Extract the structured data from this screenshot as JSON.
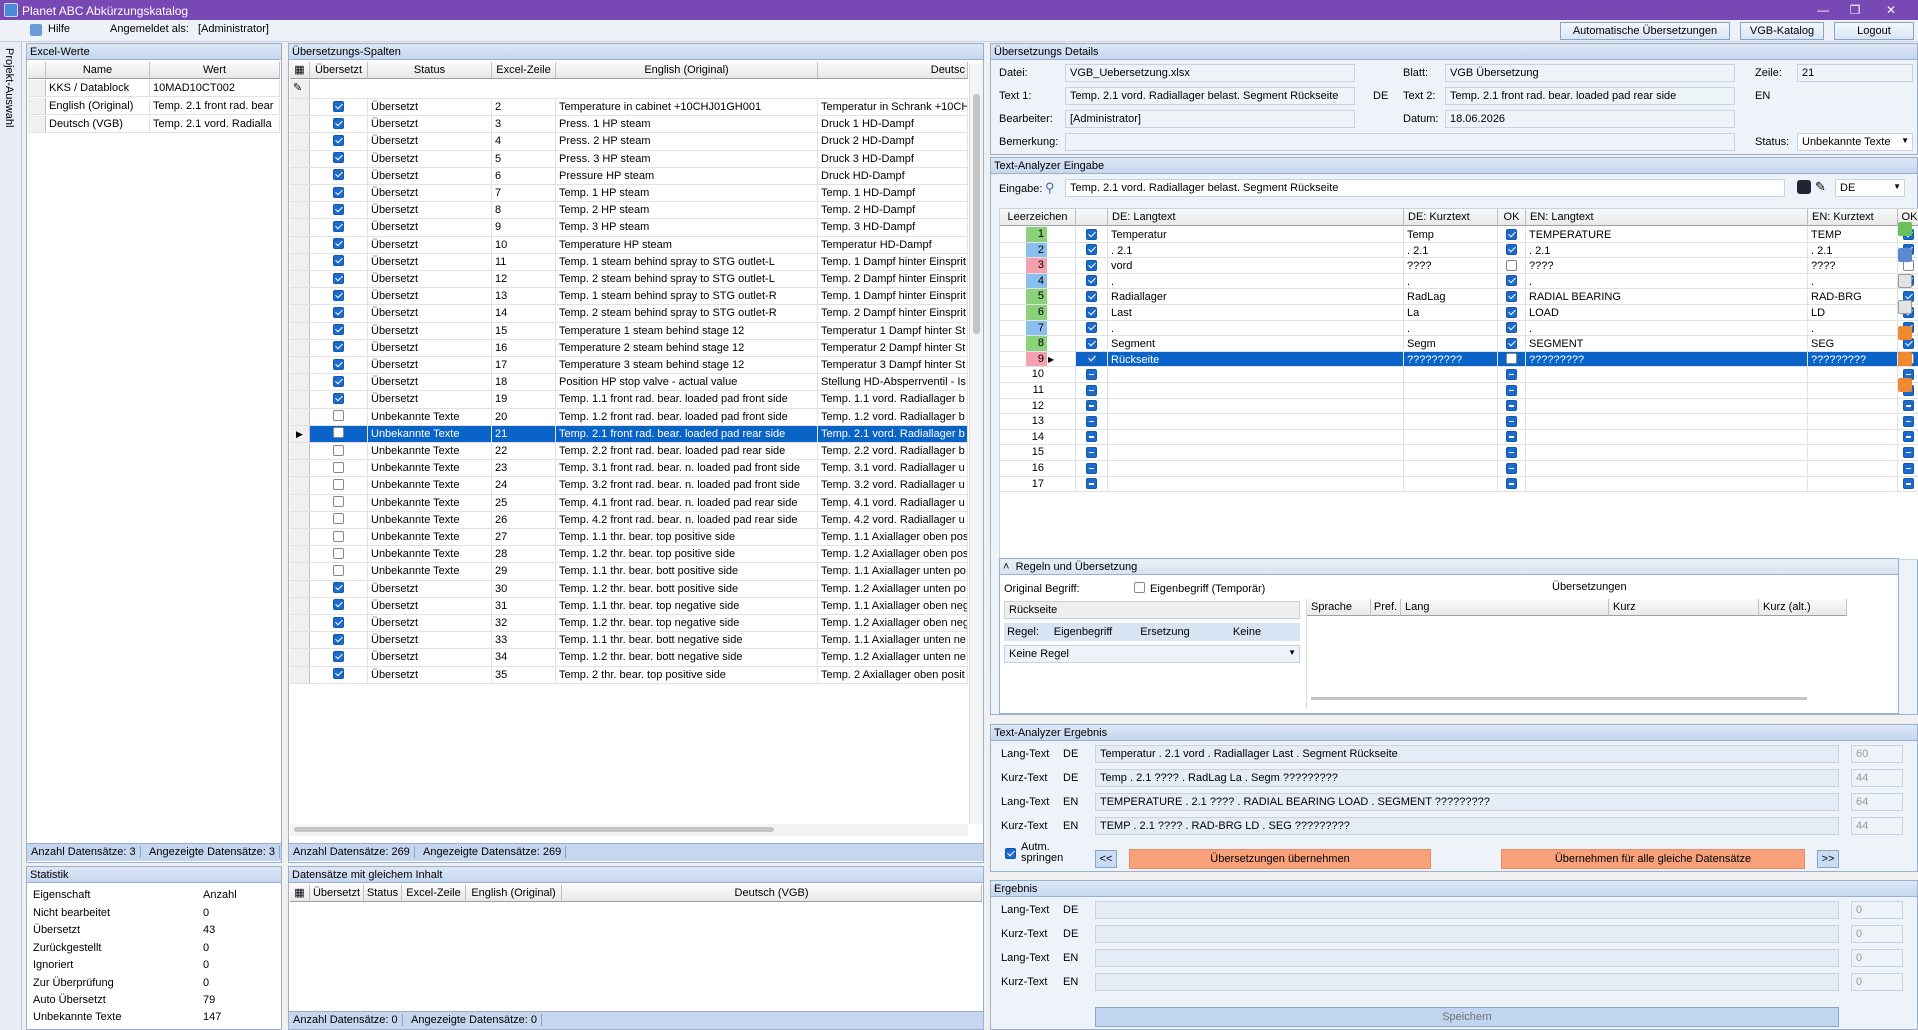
{
  "window": {
    "title": "Planet ABC Abkürzungskatalog"
  },
  "menu": {
    "help": "Hilfe",
    "logged_in_label": "Angemeldet als:",
    "logged_in_user": "[Administrator]",
    "btn_auto": "Automatische Übersetzungen",
    "btn_vgb": "VGB-Katalog",
    "btn_logout": "Logout"
  },
  "side": {
    "label": "Projekt-Auswahl"
  },
  "excel": {
    "title": "Excel-Werte",
    "col_name": "Name",
    "col_value": "Wert",
    "rows": [
      {
        "name": "KKS / Datablock",
        "value": "10MAD10CT002"
      },
      {
        "name": "English (Original)",
        "value": "Temp. 2.1 front rad. bear"
      },
      {
        "name": "Deutsch (VGB)",
        "value": "Temp. 2.1 vord. Radialla"
      }
    ],
    "count": "Anzahl Datensätze: 3",
    "shown": "Angezeigte Datensätze: 3"
  },
  "stats": {
    "title": "Statistik",
    "col_prop": "Eigenschaft",
    "col_count": "Anzahl",
    "rows": [
      {
        "k": "Nicht bearbeitet",
        "v": "0"
      },
      {
        "k": "Übersetzt",
        "v": "43"
      },
      {
        "k": "Zurückgestellt",
        "v": "0"
      },
      {
        "k": "Ignoriert",
        "v": "0"
      },
      {
        "k": "Zur Überprüfung",
        "v": "0"
      },
      {
        "k": "Auto Übersetzt",
        "v": "79"
      },
      {
        "k": "Unbekannte Texte",
        "v": "147"
      }
    ]
  },
  "trans": {
    "title": "Übersetzungs-Spalten",
    "col_ue": "Übersetzt",
    "col_status": "Status",
    "col_zeile": "Excel-Zeile",
    "col_en": "English (Original)",
    "col_de": "Deutsc",
    "rows": [
      {
        "c": true,
        "s": "Übersetzt",
        "z": "2",
        "en": "Temperature in cabinet +10CHJ01GH001",
        "de": "Temperatur in Schrank +10CH"
      },
      {
        "c": true,
        "s": "Übersetzt",
        "z": "3",
        "en": "Press. 1 HP steam",
        "de": "Druck 1 HD-Dampf"
      },
      {
        "c": true,
        "s": "Übersetzt",
        "z": "4",
        "en": "Press. 2 HP steam",
        "de": "Druck 2 HD-Dampf"
      },
      {
        "c": true,
        "s": "Übersetzt",
        "z": "5",
        "en": "Press. 3 HP steam",
        "de": "Druck 3 HD-Dampf"
      },
      {
        "c": true,
        "s": "Übersetzt",
        "z": "6",
        "en": "Pressure HP steam",
        "de": "Druck HD-Dampf"
      },
      {
        "c": true,
        "s": "Übersetzt",
        "z": "7",
        "en": "Temp. 1 HP steam",
        "de": "Temp. 1 HD-Dampf"
      },
      {
        "c": true,
        "s": "Übersetzt",
        "z": "8",
        "en": "Temp. 2 HP steam",
        "de": "Temp. 2 HD-Dampf"
      },
      {
        "c": true,
        "s": "Übersetzt",
        "z": "9",
        "en": "Temp. 3 HP steam",
        "de": "Temp. 3 HD-Dampf"
      },
      {
        "c": true,
        "s": "Übersetzt",
        "z": "10",
        "en": "Temperature HP steam",
        "de": "Temperatur HD-Dampf"
      },
      {
        "c": true,
        "s": "Übersetzt",
        "z": "11",
        "en": "Temp. 1 steam behind spray to STG outlet-L",
        "de": "Temp. 1 Dampf hinter Einsprit"
      },
      {
        "c": true,
        "s": "Übersetzt",
        "z": "12",
        "en": "Temp. 2 steam behind spray to STG outlet-L",
        "de": "Temp. 2 Dampf hinter Einsprit"
      },
      {
        "c": true,
        "s": "Übersetzt",
        "z": "13",
        "en": "Temp. 1 steam behind spray to STG outlet-R",
        "de": "Temp. 1 Dampf hinter Einsprit"
      },
      {
        "c": true,
        "s": "Übersetzt",
        "z": "14",
        "en": "Temp. 2 steam behind spray to STG outlet-R",
        "de": "Temp. 2 Dampf hinter Einsprit"
      },
      {
        "c": true,
        "s": "Übersetzt",
        "z": "15",
        "en": "Temperature 1 steam behind stage 12",
        "de": "Temperatur 1 Dampf hinter St"
      },
      {
        "c": true,
        "s": "Übersetzt",
        "z": "16",
        "en": "Temperature 2 steam behind stage 12",
        "de": "Temperatur 2 Dampf hinter St"
      },
      {
        "c": true,
        "s": "Übersetzt",
        "z": "17",
        "en": "Temperature 3 steam behind stage 12",
        "de": "Temperatur 3 Dampf hinter St"
      },
      {
        "c": true,
        "s": "Übersetzt",
        "z": "18",
        "en": "Position HP stop valve - actual value",
        "de": "Stellung HD-Absperrventil - Is"
      },
      {
        "c": true,
        "s": "Übersetzt",
        "z": "19",
        "en": "Temp. 1.1 front rad. bear. loaded pad front side",
        "de": "Temp. 1.1 vord. Radiallager b"
      },
      {
        "c": false,
        "s": "Unbekannte Texte",
        "z": "20",
        "en": "Temp. 1.2 front rad. bear. loaded pad front side",
        "de": "Temp. 1.2 vord. Radiallager b"
      },
      {
        "c": false,
        "s": "Unbekannte Texte",
        "z": "21",
        "en": "Temp. 2.1 front rad. bear. loaded pad rear side",
        "de": "Temp. 2.1 vord. Radiallager b",
        "sel": true
      },
      {
        "c": false,
        "s": "Unbekannte Texte",
        "z": "22",
        "en": "Temp. 2.2 front rad. bear. loaded pad rear side",
        "de": "Temp. 2.2 vord. Radiallager b"
      },
      {
        "c": false,
        "s": "Unbekannte Texte",
        "z": "23",
        "en": "Temp. 3.1 front rad. bear. n. loaded pad front side",
        "de": "Temp. 3.1 vord. Radiallager u"
      },
      {
        "c": false,
        "s": "Unbekannte Texte",
        "z": "24",
        "en": "Temp. 3.2 front rad. bear. n. loaded pad front side",
        "de": "Temp. 3.2 vord. Radiallager u"
      },
      {
        "c": false,
        "s": "Unbekannte Texte",
        "z": "25",
        "en": "Temp. 4.1 front rad. bear. n. loaded pad rear side",
        "de": "Temp. 4.1 vord. Radiallager u"
      },
      {
        "c": false,
        "s": "Unbekannte Texte",
        "z": "26",
        "en": "Temp. 4.2 front rad. bear. n. loaded pad rear side",
        "de": "Temp. 4.2 vord. Radiallager u"
      },
      {
        "c": false,
        "s": "Unbekannte Texte",
        "z": "27",
        "en": "Temp. 1.1 thr. bear. top positive side",
        "de": "Temp. 1.1 Axiallager oben pos"
      },
      {
        "c": false,
        "s": "Unbekannte Texte",
        "z": "28",
        "en": "Temp. 1.2 thr. bear. top positive side",
        "de": "Temp. 1.2 Axiallager oben pos"
      },
      {
        "c": false,
        "s": "Unbekannte Texte",
        "z": "29",
        "en": "Temp. 1.1 thr. bear. bott positive side",
        "de": "Temp. 1.1 Axiallager unten po"
      },
      {
        "c": true,
        "s": "Übersetzt",
        "z": "30",
        "en": "Temp. 1.2 thr. bear. bott positive side",
        "de": "Temp. 1.2 Axiallager unten po"
      },
      {
        "c": true,
        "s": "Übersetzt",
        "z": "31",
        "en": "Temp. 1.1 thr. bear. top negative side",
        "de": "Temp. 1.1 Axiallager oben neg"
      },
      {
        "c": true,
        "s": "Übersetzt",
        "z": "32",
        "en": "Temp. 1.2 thr. bear. top negative side",
        "de": "Temp. 1.2 Axiallager oben neg"
      },
      {
        "c": true,
        "s": "Übersetzt",
        "z": "33",
        "en": "Temp. 1.1 thr. bear. bott negative side",
        "de": "Temp. 1.1 Axiallager unten ne"
      },
      {
        "c": true,
        "s": "Übersetzt",
        "z": "34",
        "en": "Temp. 1.2 thr. bear. bott negative side",
        "de": "Temp. 1.2 Axiallager unten ne"
      },
      {
        "c": true,
        "s": "Übersetzt",
        "z": "35",
        "en": "Temp. 2 thr. bear. top positive side",
        "de": "Temp. 2 Axiallager oben posit"
      }
    ],
    "count": "Anzahl Datensätze: 269",
    "shown": "Angezeigte Datensätze: 269"
  },
  "same": {
    "title": "Datensätze mit gleichem Inhalt",
    "col_ue": "Übersetzt",
    "col_status": "Status",
    "col_zeile": "Excel-Zeile",
    "col_en": "English (Original)",
    "col_de": "Deutsch (VGB)",
    "count": "Anzahl Datensätze: 0",
    "shown": "Angezeigte Datensätze: 0"
  },
  "details": {
    "title": "Übersetzungs Details",
    "datei_l": "Datei:",
    "datei": "VGB_Uebersetzung.xlsx",
    "blatt_l": "Blatt:",
    "blatt": "VGB Übersetzung",
    "zeile_l": "Zeile:",
    "zeile": "21",
    "text1_l": "Text 1:",
    "text1": "Temp. 2.1 vord. Radiallager belast. Segment Rückseite",
    "lang1": "DE",
    "text2_l": "Text 2:",
    "text2": "Temp. 2.1 front rad. bear. loaded pad rear side",
    "lang2": "EN",
    "bearb_l": "Bearbeiter:",
    "bearb": "[Administrator]",
    "datum_l": "Datum:",
    "datum": "18.06.2026",
    "bem_l": "Bemerkung:",
    "bem": "",
    "status_l": "Status:",
    "status": "Unbekannte Texte"
  },
  "analyzer": {
    "title": "Text-Analyzer Eingabe",
    "eingabe_l": "Eingabe:",
    "eingabe": "Temp. 2.1 vord. Radiallager belast. Segment Rückseite",
    "lang": "DE",
    "col_lz": "Leerzeichen",
    "col_de_lang": "DE: Langtext",
    "col_de_kurz": "DE: Kurztext",
    "col_ok": "OK",
    "col_en_lang": "EN: Langtext",
    "col_en_kurz": "EN: Kurztext",
    "col_ok2": "OK",
    "rows": [
      {
        "n": "1",
        "col": "#8ad27a",
        "c1": "on",
        "dl": "Temperatur",
        "dk": "Temp",
        "ok": "on",
        "el": "TEMPERATURE",
        "ek": "TEMP",
        "ok2": "on"
      },
      {
        "n": "2",
        "col": "#8ac0f0",
        "c1": "on",
        "dl": ". 2.1",
        "dk": ". 2.1",
        "ok": "on",
        "el": ". 2.1",
        "ek": ". 2.1",
        "ok2": "on"
      },
      {
        "n": "3",
        "col": "#f4a0b0",
        "c1": "on",
        "dl": "vord",
        "dk": "????",
        "ok": "off",
        "el": "????",
        "ek": "????",
        "ok2": "off"
      },
      {
        "n": "4",
        "col": "#8ac0f0",
        "c1": "on",
        "dl": ".",
        "dk": ".",
        "ok": "on",
        "el": ".",
        "ek": ".",
        "ok2": "on"
      },
      {
        "n": "5",
        "col": "#8ad27a",
        "c1": "on",
        "dl": "Radiallager",
        "dk": "RadLag",
        "ok": "on",
        "el": "RADIAL BEARING",
        "ek": "RAD-BRG",
        "ok2": "on"
      },
      {
        "n": "6",
        "col": "#8ad27a",
        "c1": "on",
        "dl": "Last",
        "dk": "La",
        "ok": "on",
        "el": "LOAD",
        "ek": "LD",
        "ok2": "on"
      },
      {
        "n": "7",
        "col": "#8ac0f0",
        "c1": "on",
        "dl": ".",
        "dk": ".",
        "ok": "on",
        "el": ".",
        "ek": ".",
        "ok2": "on"
      },
      {
        "n": "8",
        "col": "#8ad27a",
        "c1": "on",
        "dl": "Segment",
        "dk": "Segm",
        "ok": "on",
        "el": "SEGMENT",
        "ek": "SEG",
        "ok2": "on"
      },
      {
        "n": "9",
        "col": "#f4a0b0",
        "c1": "on",
        "dl": "Rückseite",
        "dk": "?????????",
        "ok": "off",
        "el": "?????????",
        "ek": "?????????",
        "ok2": "off",
        "sel": true
      },
      {
        "n": "10",
        "col": "",
        "c1": "ind",
        "dl": "",
        "dk": "",
        "ok": "ind",
        "el": "",
        "ek": "",
        "ok2": "ind"
      },
      {
        "n": "11",
        "col": "",
        "c1": "ind",
        "dl": "",
        "dk": "",
        "ok": "ind",
        "el": "",
        "ek": "",
        "ok2": "ind"
      },
      {
        "n": "12",
        "col": "",
        "c1": "ind",
        "dl": "",
        "dk": "",
        "ok": "ind",
        "el": "",
        "ek": "",
        "ok2": "ind"
      },
      {
        "n": "13",
        "col": "",
        "c1": "ind",
        "dl": "",
        "dk": "",
        "ok": "ind",
        "el": "",
        "ek": "",
        "ok2": "ind"
      },
      {
        "n": "14",
        "col": "",
        "c1": "ind",
        "dl": "",
        "dk": "",
        "ok": "ind",
        "el": "",
        "ek": "",
        "ok2": "ind"
      },
      {
        "n": "15",
        "col": "",
        "c1": "ind",
        "dl": "",
        "dk": "",
        "ok": "ind",
        "el": "",
        "ek": "",
        "ok2": "ind"
      },
      {
        "n": "16",
        "col": "",
        "c1": "ind",
        "dl": "",
        "dk": "",
        "ok": "ind",
        "el": "",
        "ek": "",
        "ok2": "ind"
      },
      {
        "n": "17",
        "col": "",
        "c1": "ind",
        "dl": "",
        "dk": "",
        "ok": "ind",
        "el": "",
        "ek": "",
        "ok2": "ind"
      }
    ]
  },
  "rules": {
    "title": "Regeln und Übersetzung",
    "orig_l": "Original Begriff:",
    "eigen_l": "Eigenbegriff (Temporär)",
    "orig": "Rückseite",
    "regel_l": "Regel:",
    "tab1": "Eigenbegriff",
    "tab2": "Ersetzung",
    "tab3": "Keine",
    "select": "Keine Regel",
    "uebers": "Übersetzungen",
    "col_sprache": "Sprache",
    "col_pref": "Pref.",
    "col_lang": "Lang",
    "col_kurz": "Kurz",
    "col_kurz_alt": "Kurz (alt.)"
  },
  "result": {
    "title": "Text-Analyzer Ergebnis",
    "rows": [
      {
        "type": "Lang-Text",
        "lang": "DE",
        "text": "Temperatur . 2.1 vord . Radiallager Last . Segment Rückseite",
        "len": "60"
      },
      {
        "type": "Kurz-Text",
        "lang": "DE",
        "text": "Temp . 2.1 ???? . RadLag La . Segm ?????????",
        "len": "44"
      },
      {
        "type": "Lang-Text",
        "lang": "EN",
        "text": "TEMPERATURE . 2.1 ???? . RADIAL BEARING LOAD . SEGMENT ?????????",
        "len": "64"
      },
      {
        "type": "Kurz-Text",
        "lang": "EN",
        "text": "TEMP . 2.1 ???? . RAD-BRG LD . SEG ?????????",
        "len": "44"
      }
    ],
    "auto": "Autm. springen",
    "prev": "<<",
    "take": "Übersetzungen übernehmen",
    "take_all": "Übernehmen für alle gleiche Datensätze",
    "next": ">>"
  },
  "final": {
    "title": "Ergebnis",
    "rows": [
      {
        "type": "Lang-Text",
        "lang": "DE",
        "len": "0"
      },
      {
        "type": "Kurz-Text",
        "lang": "DE",
        "len": "0"
      },
      {
        "type": "Lang-Text",
        "lang": "EN",
        "len": "0"
      },
      {
        "type": "Kurz-Text",
        "lang": "EN",
        "len": "0"
      }
    ],
    "save": "Speichern"
  }
}
